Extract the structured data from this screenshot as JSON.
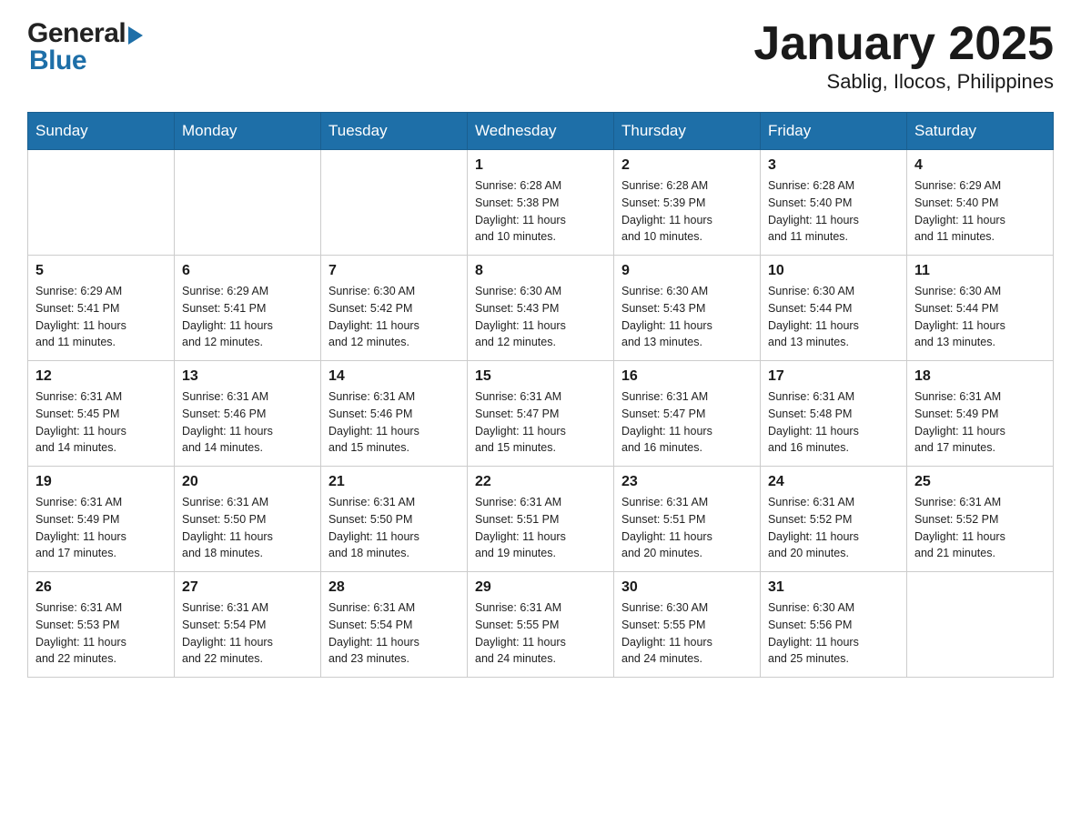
{
  "header": {
    "title": "January 2025",
    "subtitle": "Sablig, Ilocos, Philippines"
  },
  "logo": {
    "general": "General",
    "blue": "Blue"
  },
  "days_of_week": [
    "Sunday",
    "Monday",
    "Tuesday",
    "Wednesday",
    "Thursday",
    "Friday",
    "Saturday"
  ],
  "weeks": [
    [
      {
        "day": "",
        "info": ""
      },
      {
        "day": "",
        "info": ""
      },
      {
        "day": "",
        "info": ""
      },
      {
        "day": "1",
        "info": "Sunrise: 6:28 AM\nSunset: 5:38 PM\nDaylight: 11 hours\nand 10 minutes."
      },
      {
        "day": "2",
        "info": "Sunrise: 6:28 AM\nSunset: 5:39 PM\nDaylight: 11 hours\nand 10 minutes."
      },
      {
        "day": "3",
        "info": "Sunrise: 6:28 AM\nSunset: 5:40 PM\nDaylight: 11 hours\nand 11 minutes."
      },
      {
        "day": "4",
        "info": "Sunrise: 6:29 AM\nSunset: 5:40 PM\nDaylight: 11 hours\nand 11 minutes."
      }
    ],
    [
      {
        "day": "5",
        "info": "Sunrise: 6:29 AM\nSunset: 5:41 PM\nDaylight: 11 hours\nand 11 minutes."
      },
      {
        "day": "6",
        "info": "Sunrise: 6:29 AM\nSunset: 5:41 PM\nDaylight: 11 hours\nand 12 minutes."
      },
      {
        "day": "7",
        "info": "Sunrise: 6:30 AM\nSunset: 5:42 PM\nDaylight: 11 hours\nand 12 minutes."
      },
      {
        "day": "8",
        "info": "Sunrise: 6:30 AM\nSunset: 5:43 PM\nDaylight: 11 hours\nand 12 minutes."
      },
      {
        "day": "9",
        "info": "Sunrise: 6:30 AM\nSunset: 5:43 PM\nDaylight: 11 hours\nand 13 minutes."
      },
      {
        "day": "10",
        "info": "Sunrise: 6:30 AM\nSunset: 5:44 PM\nDaylight: 11 hours\nand 13 minutes."
      },
      {
        "day": "11",
        "info": "Sunrise: 6:30 AM\nSunset: 5:44 PM\nDaylight: 11 hours\nand 13 minutes."
      }
    ],
    [
      {
        "day": "12",
        "info": "Sunrise: 6:31 AM\nSunset: 5:45 PM\nDaylight: 11 hours\nand 14 minutes."
      },
      {
        "day": "13",
        "info": "Sunrise: 6:31 AM\nSunset: 5:46 PM\nDaylight: 11 hours\nand 14 minutes."
      },
      {
        "day": "14",
        "info": "Sunrise: 6:31 AM\nSunset: 5:46 PM\nDaylight: 11 hours\nand 15 minutes."
      },
      {
        "day": "15",
        "info": "Sunrise: 6:31 AM\nSunset: 5:47 PM\nDaylight: 11 hours\nand 15 minutes."
      },
      {
        "day": "16",
        "info": "Sunrise: 6:31 AM\nSunset: 5:47 PM\nDaylight: 11 hours\nand 16 minutes."
      },
      {
        "day": "17",
        "info": "Sunrise: 6:31 AM\nSunset: 5:48 PM\nDaylight: 11 hours\nand 16 minutes."
      },
      {
        "day": "18",
        "info": "Sunrise: 6:31 AM\nSunset: 5:49 PM\nDaylight: 11 hours\nand 17 minutes."
      }
    ],
    [
      {
        "day": "19",
        "info": "Sunrise: 6:31 AM\nSunset: 5:49 PM\nDaylight: 11 hours\nand 17 minutes."
      },
      {
        "day": "20",
        "info": "Sunrise: 6:31 AM\nSunset: 5:50 PM\nDaylight: 11 hours\nand 18 minutes."
      },
      {
        "day": "21",
        "info": "Sunrise: 6:31 AM\nSunset: 5:50 PM\nDaylight: 11 hours\nand 18 minutes."
      },
      {
        "day": "22",
        "info": "Sunrise: 6:31 AM\nSunset: 5:51 PM\nDaylight: 11 hours\nand 19 minutes."
      },
      {
        "day": "23",
        "info": "Sunrise: 6:31 AM\nSunset: 5:51 PM\nDaylight: 11 hours\nand 20 minutes."
      },
      {
        "day": "24",
        "info": "Sunrise: 6:31 AM\nSunset: 5:52 PM\nDaylight: 11 hours\nand 20 minutes."
      },
      {
        "day": "25",
        "info": "Sunrise: 6:31 AM\nSunset: 5:52 PM\nDaylight: 11 hours\nand 21 minutes."
      }
    ],
    [
      {
        "day": "26",
        "info": "Sunrise: 6:31 AM\nSunset: 5:53 PM\nDaylight: 11 hours\nand 22 minutes."
      },
      {
        "day": "27",
        "info": "Sunrise: 6:31 AM\nSunset: 5:54 PM\nDaylight: 11 hours\nand 22 minutes."
      },
      {
        "day": "28",
        "info": "Sunrise: 6:31 AM\nSunset: 5:54 PM\nDaylight: 11 hours\nand 23 minutes."
      },
      {
        "day": "29",
        "info": "Sunrise: 6:31 AM\nSunset: 5:55 PM\nDaylight: 11 hours\nand 24 minutes."
      },
      {
        "day": "30",
        "info": "Sunrise: 6:30 AM\nSunset: 5:55 PM\nDaylight: 11 hours\nand 24 minutes."
      },
      {
        "day": "31",
        "info": "Sunrise: 6:30 AM\nSunset: 5:56 PM\nDaylight: 11 hours\nand 25 minutes."
      },
      {
        "day": "",
        "info": ""
      }
    ]
  ]
}
